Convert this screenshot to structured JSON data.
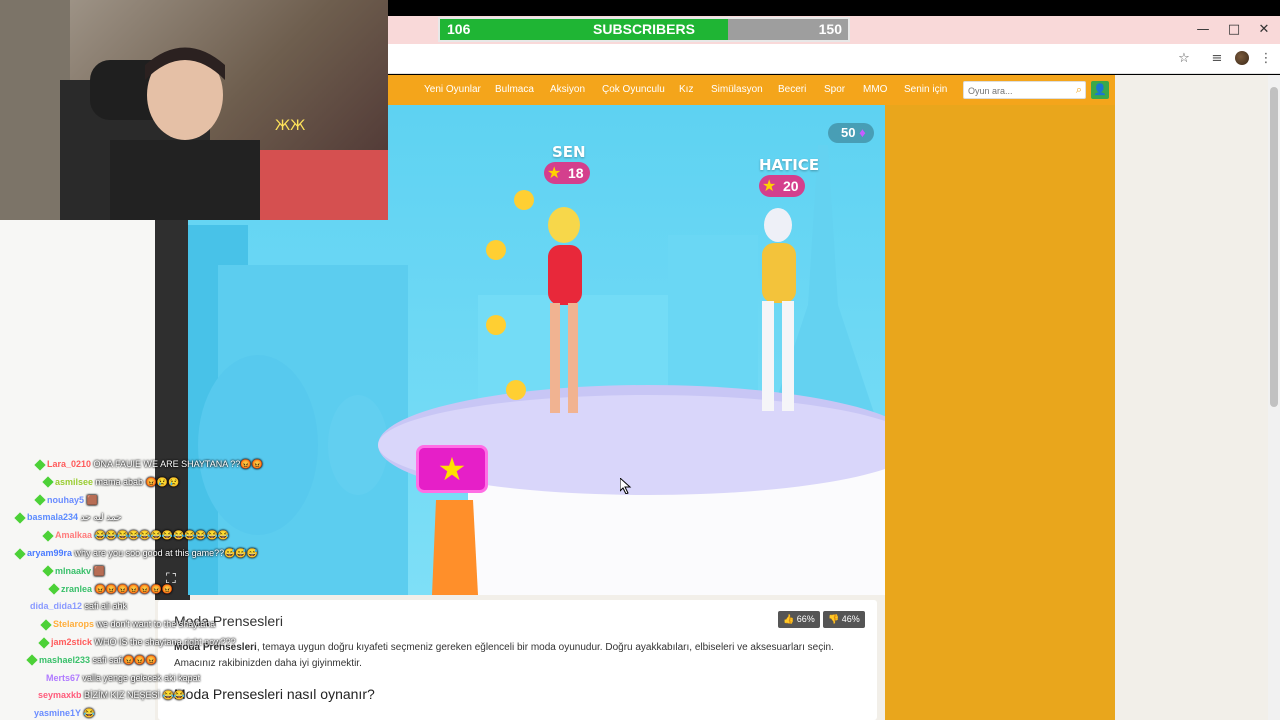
{
  "stream": {
    "subscribers": {
      "current": "106",
      "label": "SUBSCRIBERS",
      "goal": "150",
      "progress": 0.707
    }
  },
  "browser": {
    "window_controls": [
      "—",
      "□",
      "✕"
    ],
    "toolbar_icons": [
      "star-icon",
      "media-icon",
      "profile-avatar",
      "menu-icon"
    ]
  },
  "site": {
    "nav": [
      "Yeni Oyunlar",
      "Bulmaca",
      "Aksiyon",
      "Çok Oyunculu",
      "Kız",
      "Simülasyon",
      "Beceri",
      "Spor",
      "MMO",
      "Senin için"
    ],
    "search": {
      "placeholder": "Oyun ara..."
    },
    "accent": "#f4a51b"
  },
  "game": {
    "gems": "50",
    "players": [
      {
        "name": "SEN",
        "score": "18"
      },
      {
        "name": "HATICE",
        "score": "20"
      }
    ]
  },
  "description": {
    "title": "Moda Prensesleri",
    "likes": "66%",
    "dislikes": "46%",
    "bold_name": "Moda Prensesleri",
    "text": ", temaya uygun doğru kıyafeti seçmeniz gereken eğlenceli bir moda oyunudur. Doğru ayakkabıları, elbiseleri ve aksesuarları seçin. Amacınız rakibinizden daha iyi giyinmektir.",
    "howto": "Moda Prensesleri nasıl oynanır?"
  },
  "chat": [
    {
      "user": "Lara_0210",
      "color": "#ff5b5b",
      "badge": true,
      "msg": "ONA FAUIE WE ARE SHAYTANA ??😡😡"
    },
    {
      "user": "asmilsee",
      "color": "#9acd32",
      "badge": true,
      "msg": "mama abab 😡😢😢"
    },
    {
      "user": "nouhay5",
      "color": "#6a8cff",
      "badge": true,
      "msg": "🟫"
    },
    {
      "user": "basmala234",
      "color": "#5b8bff",
      "badge": true,
      "msg": "حمد ليه حد"
    },
    {
      "user": "Amalkaa",
      "color": "#ff7b7b",
      "badge": true,
      "msg": "😂😂😂😂😂😂😂😂😂😂😂😂"
    },
    {
      "user": "aryam99ra",
      "color": "#4a7bff",
      "badge": true,
      "msg": "why are you soo good at this game??😅😅😅"
    },
    {
      "user": "mlnaakv",
      "color": "#39c06a",
      "badge": true,
      "msg": "🟫"
    },
    {
      "user": "zranlea",
      "color": "#39c06a",
      "badge": true,
      "msg": "😡😡😡😡😡😡😡"
    },
    {
      "user": "dida_dida12",
      "color": "#8a9aff",
      "badge": false,
      "msg": "safi ali ahk"
    },
    {
      "user": "Stelarops",
      "color": "#ffae3b",
      "badge": true,
      "msg": "we don't want to the shaytana"
    },
    {
      "user": "jam2stick",
      "color": "#ff5b5b",
      "badge": true,
      "msg": "WHO IS the shaytana right now???"
    },
    {
      "user": "mashael233",
      "color": "#39c06a",
      "badge": true,
      "msg": "safi safi😡😡😡"
    },
    {
      "user": "Merts67",
      "color": "#b07bff",
      "badge": false,
      "msg": "valla yenge gelecek aki kapat"
    },
    {
      "user": "seymaxkb",
      "color": "#ff5b7b",
      "badge": false,
      "msg": "BİZİM KIZ NEŞESİ 😂😂"
    },
    {
      "user": "yasmine1Y",
      "color": "#6a8cff",
      "badge": false,
      "msg": "😂"
    }
  ]
}
